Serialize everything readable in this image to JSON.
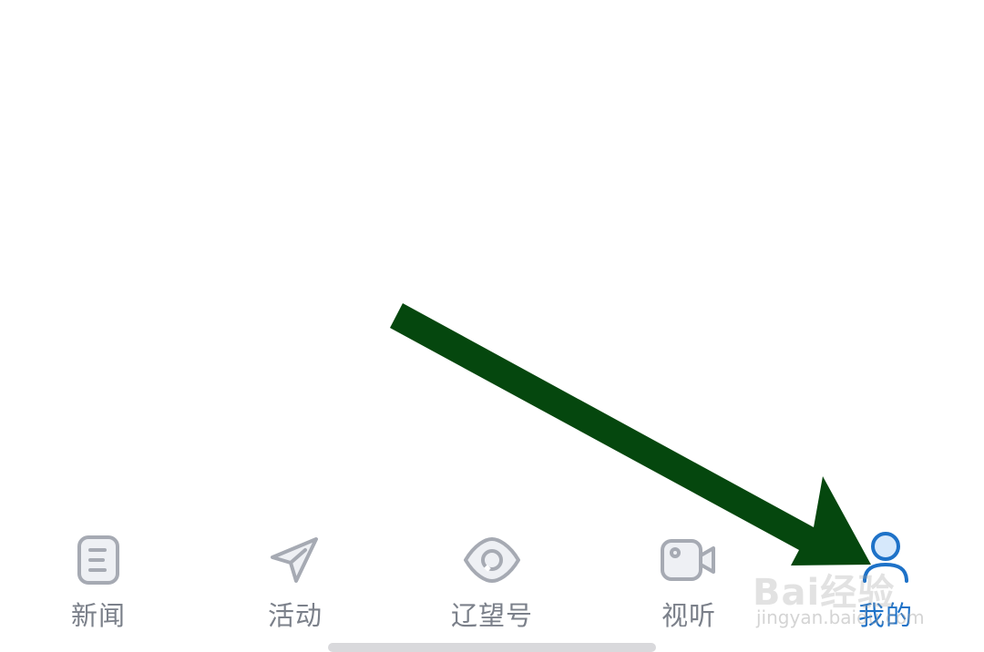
{
  "tabbar": {
    "tabs": [
      {
        "label": "新闻",
        "icon": "news-document-icon"
      },
      {
        "label": "活动",
        "icon": "paper-plane-icon"
      },
      {
        "label": "辽望号",
        "icon": "eye-icon"
      },
      {
        "label": "视听",
        "icon": "video-camera-icon"
      },
      {
        "label": "我的",
        "icon": "user-profile-icon",
        "active": true
      }
    ]
  },
  "colors": {
    "inactive": "#7b808a",
    "inactive_icon": "#a6aab3",
    "active": "#1e72c8",
    "annotation_arrow": "#05470e"
  },
  "watermark": {
    "logo_text": "Bai经验",
    "url_text": "jingyan.baidu.com"
  }
}
